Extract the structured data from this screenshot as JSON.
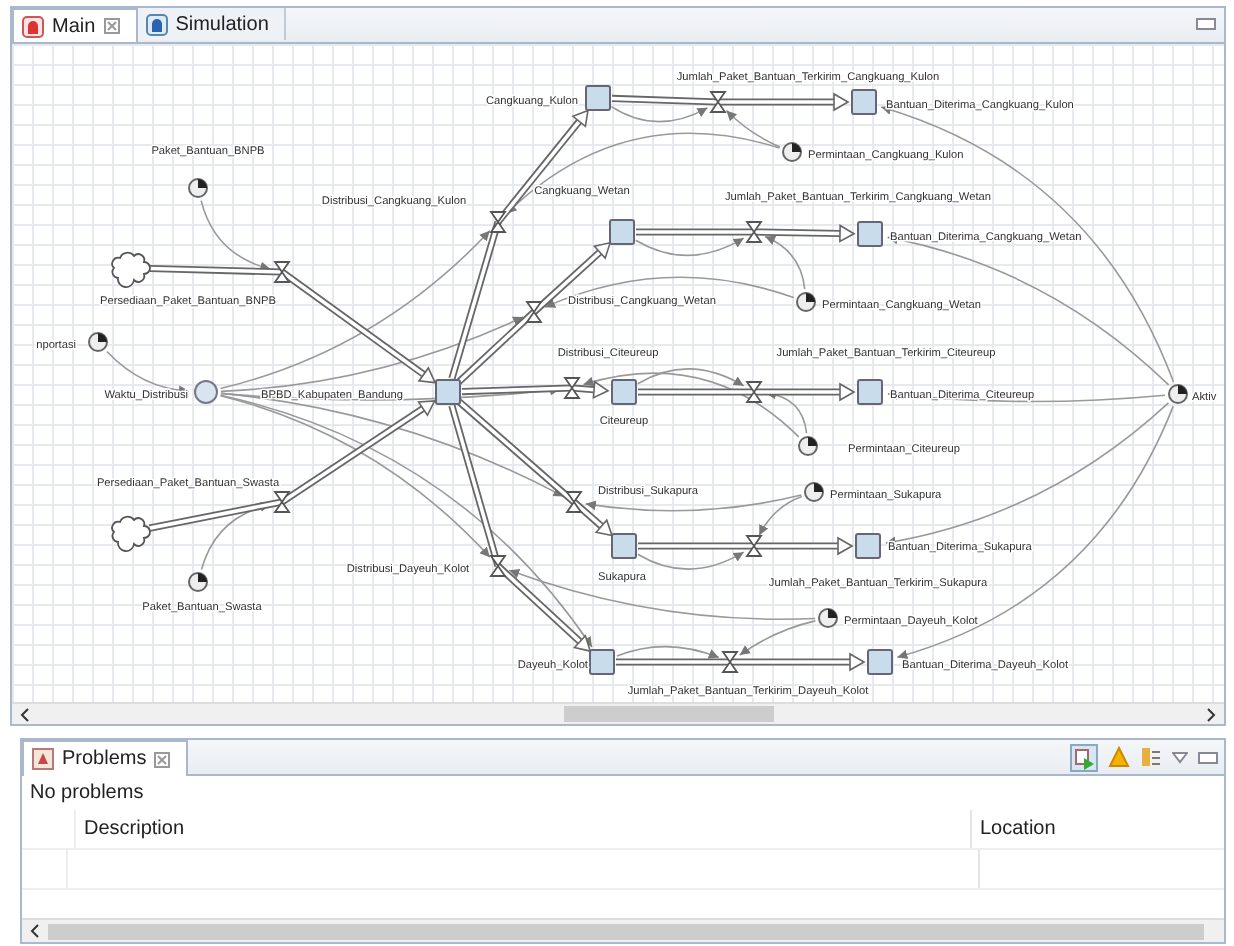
{
  "editor": {
    "tabs": [
      {
        "label": "Main",
        "selected": true,
        "closable": true
      },
      {
        "label": "Simulation",
        "selected": false,
        "closable": false
      }
    ],
    "diagram": {
      "nodes": [
        {
          "kind": "parameter",
          "label": "Paket_Bantuan_BNPB"
        },
        {
          "kind": "cloud"
        },
        {
          "kind": "flow",
          "label": "Persediaan_Paket_Bantuan_BNPB"
        },
        {
          "kind": "parameter",
          "label": "nportasi"
        },
        {
          "kind": "variable",
          "label": "Waktu_Distribusi"
        },
        {
          "kind": "stock",
          "label": "BPBD_Kabupaten_Bandung"
        },
        {
          "kind": "flow",
          "label": "Persediaan_Paket_Bantuan_Swasta"
        },
        {
          "kind": "cloud"
        },
        {
          "kind": "parameter",
          "label": "Paket_Bantuan_Swasta"
        },
        {
          "kind": "flow",
          "label": "Distribusi_Cangkuang_Kulon"
        },
        {
          "kind": "stock",
          "label": "Cangkuang_Kulon"
        },
        {
          "kind": "flow",
          "label": "Jumlah_Paket_Bantuan_Terkirim_Cangkuang_Kulon"
        },
        {
          "kind": "stock",
          "label": "Bantuan_Diterima_Cangkuang_Kulon"
        },
        {
          "kind": "parameter",
          "label": "Permintaan_Cangkuang_Kulon"
        },
        {
          "kind": "stock",
          "label": "Cangkuang_Wetan"
        },
        {
          "kind": "flow",
          "label": "Jumlah_Paket_Bantuan_Terkirim_Cangkuang_Wetan"
        },
        {
          "kind": "stock",
          "label": "Bantuan_Diterima_Cangkuang_Wetan"
        },
        {
          "kind": "flow",
          "label": "Distribusi_Cangkuang_Wetan"
        },
        {
          "kind": "parameter",
          "label": "Permintaan_Cangkuang_Wetan"
        },
        {
          "kind": "flow",
          "label": "Distribusi_Citeureup"
        },
        {
          "kind": "stock",
          "label": "Citeureup"
        },
        {
          "kind": "flow",
          "label": "Jumlah_Paket_Bantuan_Terkirim_Citeureup"
        },
        {
          "kind": "stock",
          "label": "Bantuan_Diterima_Citeureup"
        },
        {
          "kind": "parameter",
          "label": "Permintaan_Citeureup"
        },
        {
          "kind": "parameter",
          "label": "Aktiv"
        },
        {
          "kind": "flow",
          "label": "Distribusi_Sukapura"
        },
        {
          "kind": "parameter",
          "label": "Permintaan_Sukapura"
        },
        {
          "kind": "stock",
          "label": "Sukapura"
        },
        {
          "kind": "flow",
          "label": "Jumlah_Paket_Bantuan_Terkirim_Sukapura"
        },
        {
          "kind": "stock",
          "label": "Bantuan_Diterima_Sukapura"
        },
        {
          "kind": "flow",
          "label": "Distribusi_Dayeuh_Kolot"
        },
        {
          "kind": "parameter",
          "label": "Permintaan_Dayeuh_Kolot"
        },
        {
          "kind": "stock",
          "label": "Dayeuh_Kolot"
        },
        {
          "kind": "flow",
          "label": "Jumlah_Paket_Bantuan_Terkirim_Dayeuh_Kolot"
        },
        {
          "kind": "stock",
          "label": "Bantuan_Diterima_Dayeuh_Kolot"
        }
      ]
    }
  },
  "problems_view": {
    "tab_label": "Problems",
    "summary": "No problems",
    "table": {
      "columns": [
        "Description",
        "Location"
      ]
    }
  }
}
